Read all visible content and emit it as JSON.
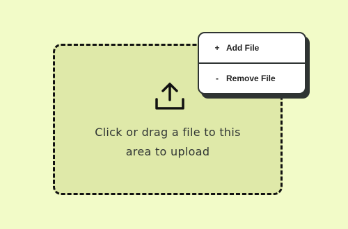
{
  "dropzone": {
    "line1": "Click or drag a file to this",
    "line2": "area to upload",
    "icon": "upload-icon"
  },
  "context_menu": {
    "items": [
      {
        "glyph": "+",
        "label": "Add File",
        "icon": "plus-icon"
      },
      {
        "glyph": "-",
        "label": "Remove File",
        "icon": "minus-icon"
      }
    ]
  },
  "colors": {
    "background": "#f2fbc8",
    "dropzone_fill": "#dfe9a9",
    "border": "#111111",
    "menu_bg": "#ffffff",
    "menu_border": "#2f3433",
    "text": "#2f3433"
  }
}
